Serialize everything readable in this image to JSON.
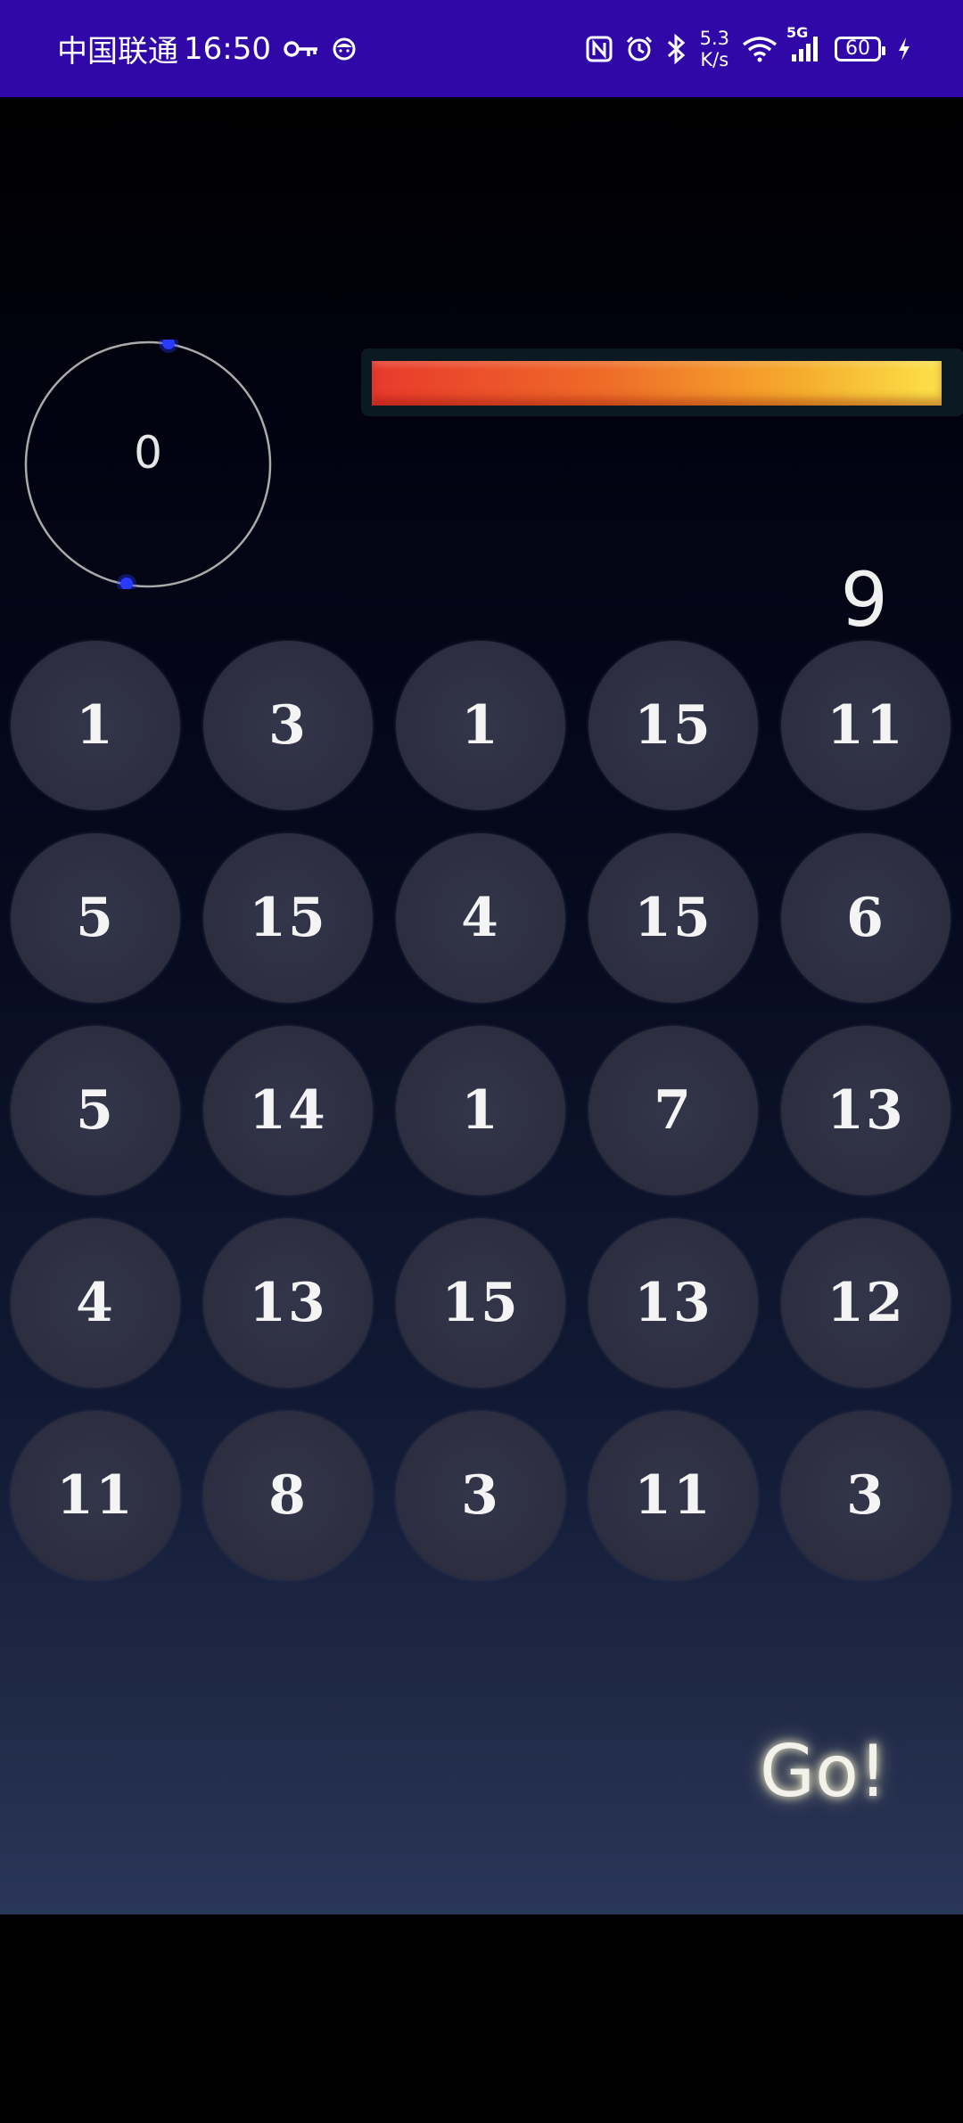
{
  "status_bar": {
    "carrier": "中国联通",
    "time": "16:50",
    "key_icon": "key-icon",
    "face_icon": "face-icon",
    "nfc_icon": "nfc-icon",
    "alarm_icon": "alarm-icon",
    "bluetooth_icon": "bluetooth-icon",
    "net_speed_value": "5.3",
    "net_speed_unit": "K/s",
    "wifi_icon": "wifi-icon",
    "signal_label": "5G",
    "signal_icon": "signal-icon",
    "battery_level": "60",
    "charging_icon": "lightning-icon",
    "background_color": "#3008a8"
  },
  "game": {
    "timer_value": "0",
    "timer_color": "#aaaaaa",
    "orbit_dot_color": "#2a3aff",
    "progress_fraction": 0.98,
    "progress_colors": [
      "#e83a2c",
      "#fbe24a"
    ],
    "target_number": "9",
    "grid": [
      [
        "1",
        "3",
        "1",
        "15",
        "11"
      ],
      [
        "5",
        "15",
        "4",
        "15",
        "6"
      ],
      [
        "5",
        "14",
        "1",
        "7",
        "13"
      ],
      [
        "4",
        "13",
        "15",
        "13",
        "12"
      ],
      [
        "11",
        "8",
        "3",
        "11",
        "3"
      ]
    ],
    "go_label": "Go!"
  }
}
